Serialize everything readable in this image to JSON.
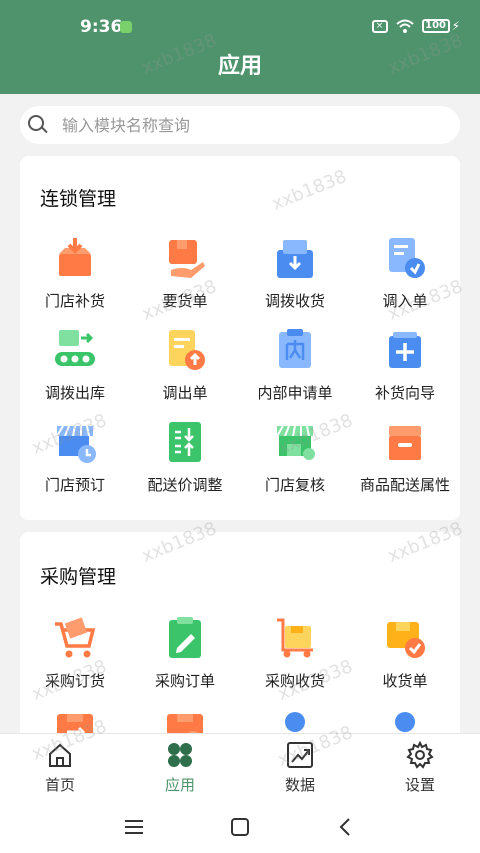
{
  "status": {
    "time": "9:36",
    "battery": "100"
  },
  "appbar": {
    "title": "应用"
  },
  "search": {
    "placeholder": "输入模块名称查询"
  },
  "chain": {
    "title": "连锁管理",
    "items": [
      {
        "label": "门店补货",
        "icon": "store-replenish-icon"
      },
      {
        "label": "要货单",
        "icon": "request-order-icon"
      },
      {
        "label": "调拨收货",
        "icon": "transfer-receive-icon"
      },
      {
        "label": "调入单",
        "icon": "transfer-in-icon"
      },
      {
        "label": "调拨出库",
        "icon": "transfer-out-icon"
      },
      {
        "label": "调出单",
        "icon": "transfer-out-order-icon"
      },
      {
        "label": "内部申请单",
        "icon": "internal-request-icon"
      },
      {
        "label": "补货向导",
        "icon": "replenish-guide-icon"
      },
      {
        "label": "门店预订",
        "icon": "store-booking-icon"
      },
      {
        "label": "配送价调整",
        "icon": "delivery-price-icon"
      },
      {
        "label": "门店复核",
        "icon": "store-review-icon"
      },
      {
        "label": "商品配送属性",
        "icon": "delivery-attr-icon"
      }
    ]
  },
  "purchase": {
    "title": "采购管理",
    "items": [
      {
        "label": "采购订货",
        "icon": "purchase-order-cart-icon"
      },
      {
        "label": "采购订单",
        "icon": "purchase-order-icon"
      },
      {
        "label": "采购收货",
        "icon": "purchase-receive-icon"
      },
      {
        "label": "收货单",
        "icon": "receipt-icon"
      },
      {
        "label": "",
        "icon": "return-box-icon"
      },
      {
        "label": "",
        "icon": "box-icon"
      },
      {
        "label": "",
        "icon": "supplier-icon"
      },
      {
        "label": "",
        "icon": "person-icon"
      }
    ]
  },
  "nav": {
    "items": [
      {
        "label": "首页",
        "icon": "home-icon",
        "active": false
      },
      {
        "label": "应用",
        "icon": "apps-icon",
        "active": true
      },
      {
        "label": "数据",
        "icon": "chart-icon",
        "active": false
      },
      {
        "label": "设置",
        "icon": "gear-icon",
        "active": false
      }
    ]
  },
  "watermark": {
    "text": "xxb1838"
  },
  "colors": {
    "primary": "#4f936c",
    "orange": "#ff7a45",
    "blue": "#4a8cf0",
    "green": "#3cc46b",
    "yellow": "#ffb11a"
  }
}
